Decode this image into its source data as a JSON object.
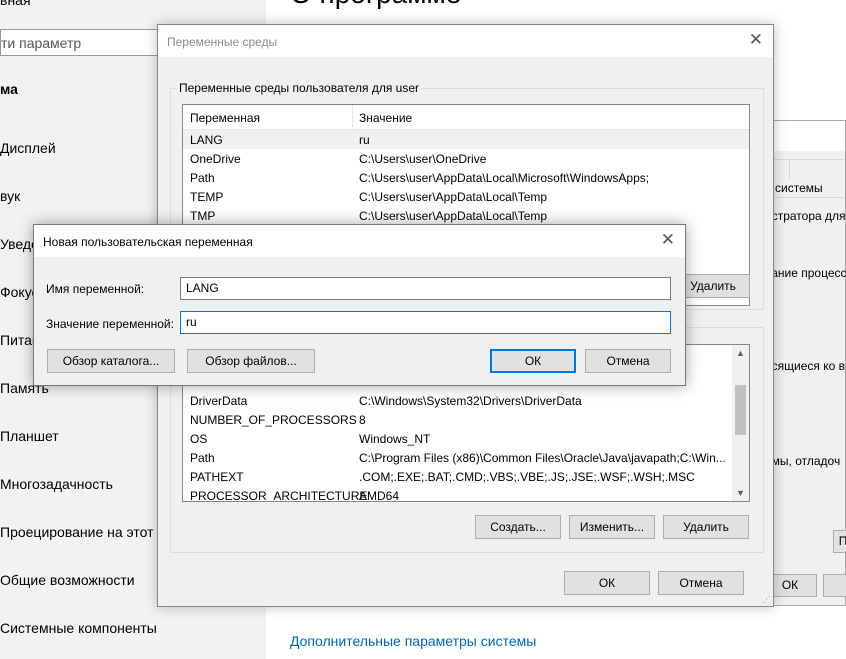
{
  "settings": {
    "top_cut_label": "вная",
    "search_placeholder": "ти параметр",
    "section_header": "ма",
    "nav": [
      "Дисплей",
      "вук",
      "Уведо",
      "Фокус",
      "Питан",
      "Память",
      "Планшет",
      "Многозадачность",
      "Проецирование на этот к",
      "Общие возможности",
      "Системные компоненты"
    ],
    "page_title": "О программе",
    "advanced_link": "Дополнительные параметры системы"
  },
  "system_properties": {
    "tab_partial": "системы",
    "text_admin": "истратора для и",
    "text_perf": "вание процесс",
    "text_profiles": "осящиеся ко в",
    "text_startup": "емы, отладоч",
    "btn_partial": "П",
    "ok_partial": "ОК"
  },
  "env_dialog": {
    "title": "Переменные среды",
    "user_group_label": "Переменные среды пользователя для user",
    "col_variable": "Переменная",
    "col_value": "Значение",
    "user_vars": [
      {
        "name": "LANG",
        "value": "ru"
      },
      {
        "name": "OneDrive",
        "value": "C:\\Users\\user\\OneDrive"
      },
      {
        "name": "Path",
        "value": "C:\\Users\\user\\AppData\\Local\\Microsoft\\WindowsApps;"
      },
      {
        "name": "TEMP",
        "value": "C:\\Users\\user\\AppData\\Local\\Temp"
      },
      {
        "name": "TMP",
        "value": "C:\\Users\\user\\AppData\\Local\\Temp"
      }
    ],
    "user_delete_button": "Удалить",
    "system_vars": [
      {
        "name": "DriverData",
        "value": "C:\\Windows\\System32\\Drivers\\DriverData"
      },
      {
        "name": "NUMBER_OF_PROCESSORS",
        "value": "8"
      },
      {
        "name": "OS",
        "value": "Windows_NT"
      },
      {
        "name": "Path",
        "value": "C:\\Program Files (x86)\\Common Files\\Oracle\\Java\\javapath;C:\\Win..."
      },
      {
        "name": "PATHEXT",
        "value": ".COM;.EXE;.BAT;.CMD;.VBS;.VBE;.JS;.JSE;.WSF;.WSH;.MSC"
      },
      {
        "name": "PROCESSOR_ARCHITECTURE",
        "value": "AMD64"
      }
    ],
    "sys_new_button": "Создать...",
    "sys_edit_button": "Изменить...",
    "sys_delete_button": "Удалить",
    "ok_button": "ОК",
    "cancel_button": "Отмена"
  },
  "new_var_dialog": {
    "title": "Новая пользовательская переменная",
    "name_label": "Имя переменной:",
    "name_value": "LANG",
    "value_label": "Значение переменной:",
    "value_value": "ru",
    "browse_dir_button": "Обзор каталога...",
    "browse_file_button": "Обзор файлов...",
    "ok_button": "ОК",
    "cancel_button": "Отмена"
  }
}
